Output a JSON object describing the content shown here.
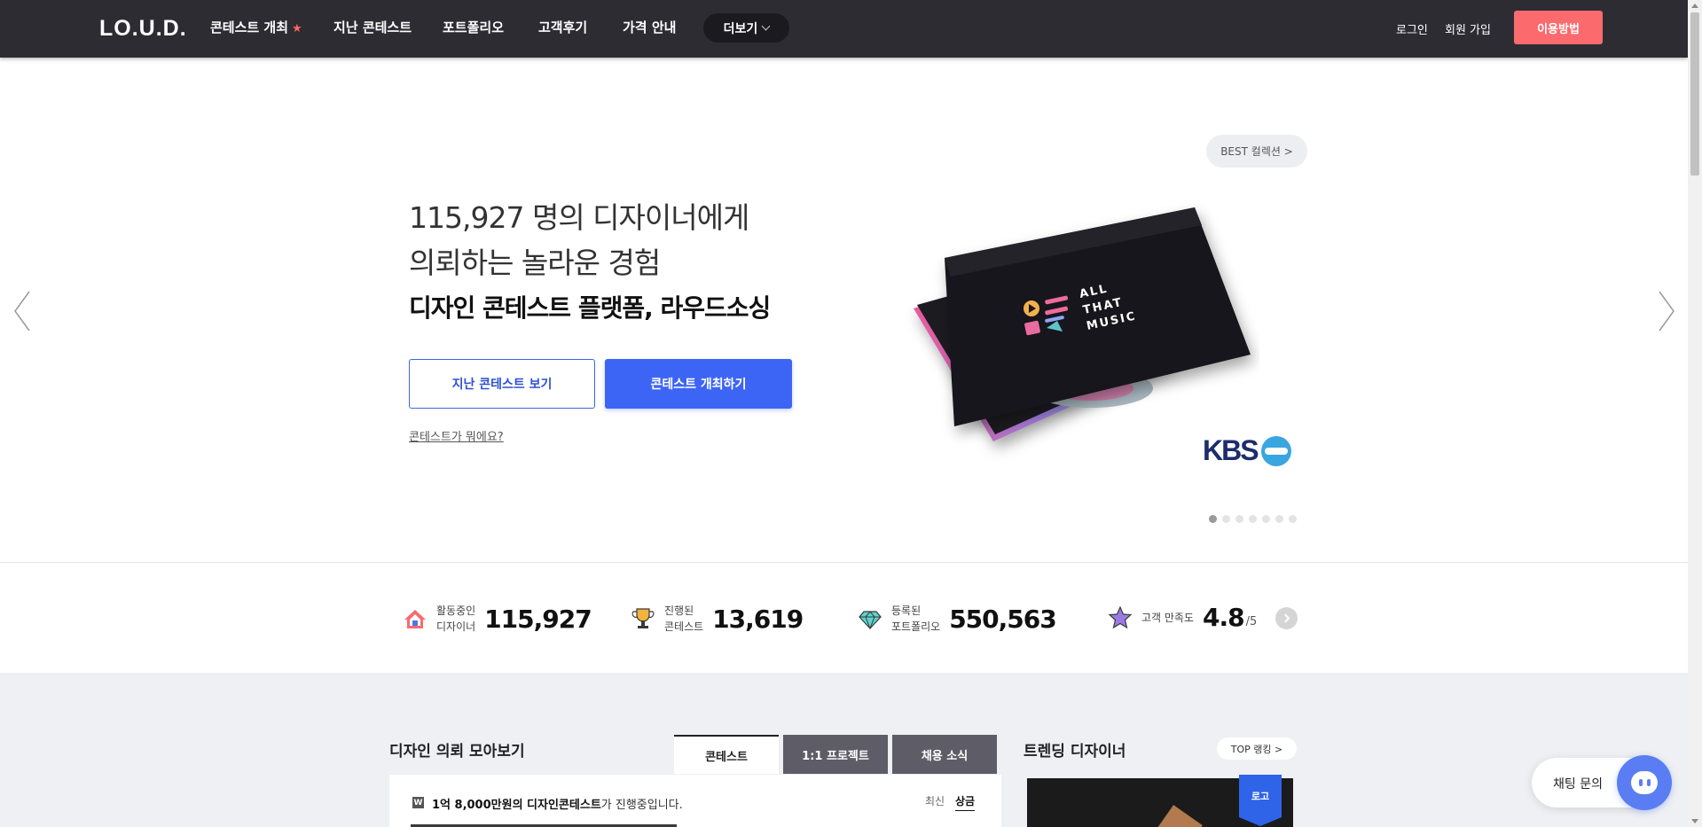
{
  "header": {
    "logo": "LO.U.D.",
    "nav": [
      {
        "label": "콘테스트 개최",
        "star": "★"
      },
      {
        "label": "지난 콘테스트"
      },
      {
        "label": "포트폴리오"
      },
      {
        "label": "고객후기"
      },
      {
        "label": "가격 안내"
      }
    ],
    "more_label": "더보기",
    "login": "로그인",
    "signup": "회원 가입",
    "usage_button": "이용방법"
  },
  "hero": {
    "best_button": "BEST 컬렉션 >",
    "line1": "115,927 명의 디자이너에게",
    "line2": "의뢰하는 놀라운 경험",
    "bold_line": "디자인 콘테스트 플랫폼, 라우드소싱",
    "btn_past": "지난 콘테스트 보기",
    "btn_host": "콘테스트 개최하기",
    "what_link": "콘테스트가 뭐에요?",
    "album_text": [
      "ALL",
      "THAT",
      "MUSIC"
    ],
    "client_logo": "KBS",
    "slide_count": 7,
    "active_slide": 1
  },
  "stats": [
    {
      "icon": "house-icon",
      "label1": "활동중인",
      "label2": "디자이너",
      "value": "115,927"
    },
    {
      "icon": "trophy-icon",
      "label1": "진행된",
      "label2": "콘테스트",
      "value": "13,619"
    },
    {
      "icon": "diamond-icon",
      "label1": "등록된",
      "label2": "포트폴리오",
      "value": "550,563"
    },
    {
      "icon": "star-icon",
      "label1": "고객 만족도",
      "label2": "",
      "value": "4.8",
      "suffix": "/5"
    }
  ],
  "requests": {
    "title": "디자인 의뢰 모아보기",
    "tabs": [
      "콘테스트",
      "1:1 프로젝트",
      "채용 소식"
    ],
    "badge": "W",
    "summary_bold": "1억 8,000만원의 디자인콘테스트",
    "summary_rest": "가 진행중입니다.",
    "sort": [
      "최신",
      "상금"
    ]
  },
  "trending": {
    "title": "트렌딩 디자이너",
    "rank_button": "TOP 랭킹 >",
    "tag": "로고"
  },
  "chat": {
    "label": "채팅 문의"
  },
  "colors": {
    "header_bg": "#2e2c33",
    "accent_blue": "#3d65f5",
    "accent_red": "#fb6a6d"
  }
}
